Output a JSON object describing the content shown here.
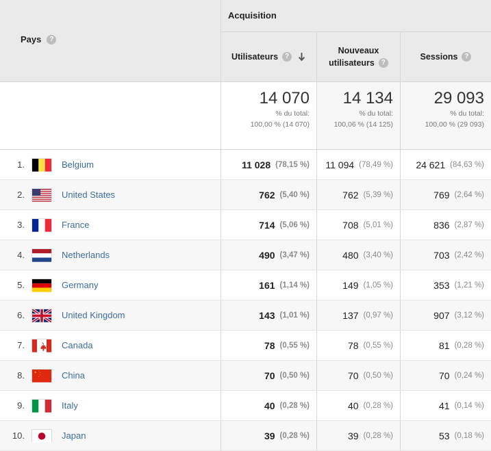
{
  "dimension_header": {
    "label": "Pays",
    "help_icon": "help-icon"
  },
  "group_header": {
    "label": "Acquisition"
  },
  "metric_headers": [
    {
      "label": "Utilisateurs",
      "label2": "",
      "help_icon": "help-icon",
      "sorted": true,
      "sort_icon": "arrow-down-icon"
    },
    {
      "label": "Nouveaux",
      "label2": "utilisateurs",
      "help_icon": "help-icon",
      "sorted": false,
      "sort_icon": ""
    },
    {
      "label": "Sessions",
      "label2": "",
      "help_icon": "help-icon",
      "sorted": false,
      "sort_icon": ""
    }
  ],
  "summary": [
    {
      "value": "14 070",
      "label": "% du total:",
      "detail": "100,00 % (14 070)"
    },
    {
      "value": "14 134",
      "label": "% du total:",
      "detail": "100,06 % (14 125)"
    },
    {
      "value": "29 093",
      "label": "% du total:",
      "detail": "100,00 % (29 093)"
    }
  ],
  "rows": [
    {
      "rank": "1.",
      "country": "Belgium",
      "flag": "flag-belgium",
      "users": "11 028",
      "users_pct": "(78,15 %)",
      "new_users": "11 094",
      "new_users_pct": "(78,49 %)",
      "sessions": "24 621",
      "sessions_pct": "(84,63 %)"
    },
    {
      "rank": "2.",
      "country": "United States",
      "flag": "flag-united-states",
      "users": "762",
      "users_pct": "(5,40 %)",
      "new_users": "762",
      "new_users_pct": "(5,39 %)",
      "sessions": "769",
      "sessions_pct": "(2,64 %)"
    },
    {
      "rank": "3.",
      "country": "France",
      "flag": "flag-france",
      "users": "714",
      "users_pct": "(5,06 %)",
      "new_users": "708",
      "new_users_pct": "(5,01 %)",
      "sessions": "836",
      "sessions_pct": "(2,87 %)"
    },
    {
      "rank": "4.",
      "country": "Netherlands",
      "flag": "flag-netherlands",
      "users": "490",
      "users_pct": "(3,47 %)",
      "new_users": "480",
      "new_users_pct": "(3,40 %)",
      "sessions": "703",
      "sessions_pct": "(2,42 %)"
    },
    {
      "rank": "5.",
      "country": "Germany",
      "flag": "flag-germany",
      "users": "161",
      "users_pct": "(1,14 %)",
      "new_users": "149",
      "new_users_pct": "(1,05 %)",
      "sessions": "353",
      "sessions_pct": "(1,21 %)"
    },
    {
      "rank": "6.",
      "country": "United Kingdom",
      "flag": "flag-united-kingdom",
      "users": "143",
      "users_pct": "(1,01 %)",
      "new_users": "137",
      "new_users_pct": "(0,97 %)",
      "sessions": "907",
      "sessions_pct": "(3,12 %)"
    },
    {
      "rank": "7.",
      "country": "Canada",
      "flag": "flag-canada",
      "users": "78",
      "users_pct": "(0,55 %)",
      "new_users": "78",
      "new_users_pct": "(0,55 %)",
      "sessions": "81",
      "sessions_pct": "(0,28 %)"
    },
    {
      "rank": "8.",
      "country": "China",
      "flag": "flag-china",
      "users": "70",
      "users_pct": "(0,50 %)",
      "new_users": "70",
      "new_users_pct": "(0,50 %)",
      "sessions": "70",
      "sessions_pct": "(0,24 %)"
    },
    {
      "rank": "9.",
      "country": "Italy",
      "flag": "flag-italy",
      "users": "40",
      "users_pct": "(0,28 %)",
      "new_users": "40",
      "new_users_pct": "(0,28 %)",
      "sessions": "41",
      "sessions_pct": "(0,14 %)"
    },
    {
      "rank": "10.",
      "country": "Japan",
      "flag": "flag-japan",
      "users": "39",
      "users_pct": "(0,28 %)",
      "new_users": "39",
      "new_users_pct": "(0,28 %)",
      "sessions": "53",
      "sessions_pct": "(0,18 %)"
    }
  ],
  "colors": {
    "header_bg": "#eaeaea",
    "link": "#3d6d9e",
    "alt_row": "#f7f7f7",
    "muted_text": "#8a8a8a"
  }
}
